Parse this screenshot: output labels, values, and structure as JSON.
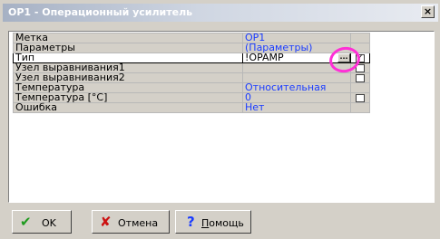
{
  "window": {
    "title": "OP1 - Операционный усилитель",
    "close_glyph": "×"
  },
  "rows": [
    {
      "name": "Метка",
      "value": "OP1",
      "checkbox": false,
      "checked": false
    },
    {
      "name": "Параметры",
      "value": "(Параметры)",
      "checkbox": false,
      "checked": false
    },
    {
      "name": "Тип",
      "value": "!OPAMP",
      "checkbox": true,
      "checked": true,
      "focused": true,
      "has_ellipsis": true
    },
    {
      "name": "Узел выравнивания1",
      "value": "",
      "checkbox": true,
      "checked": false
    },
    {
      "name": "Узел выравнивания2",
      "value": "",
      "checkbox": true,
      "checked": false
    },
    {
      "name": "Температура",
      "value": "Относительная",
      "checkbox": false,
      "checked": false
    },
    {
      "name": "Температура [°C]",
      "value": "0",
      "checkbox": true,
      "checked": false
    },
    {
      "name": "Ошибка",
      "value": "Нет",
      "checkbox": false,
      "checked": false
    }
  ],
  "ellipsis_label": "...",
  "check_glyph": "✓",
  "buttons": {
    "ok": {
      "label": "OK",
      "icon": "check-icon",
      "glyph": "✔",
      "color": "#1e9a1e"
    },
    "cancel": {
      "label": "Отмена",
      "icon": "x-icon",
      "glyph": "✘",
      "color": "#cc1111"
    },
    "help": {
      "label_first": "П",
      "label_rest": "омощь",
      "icon": "question-icon",
      "glyph": "?",
      "color": "#1a3cff"
    }
  },
  "colors": {
    "value_text": "#1a3cff",
    "highlight_circle": "#ff2fd6"
  }
}
